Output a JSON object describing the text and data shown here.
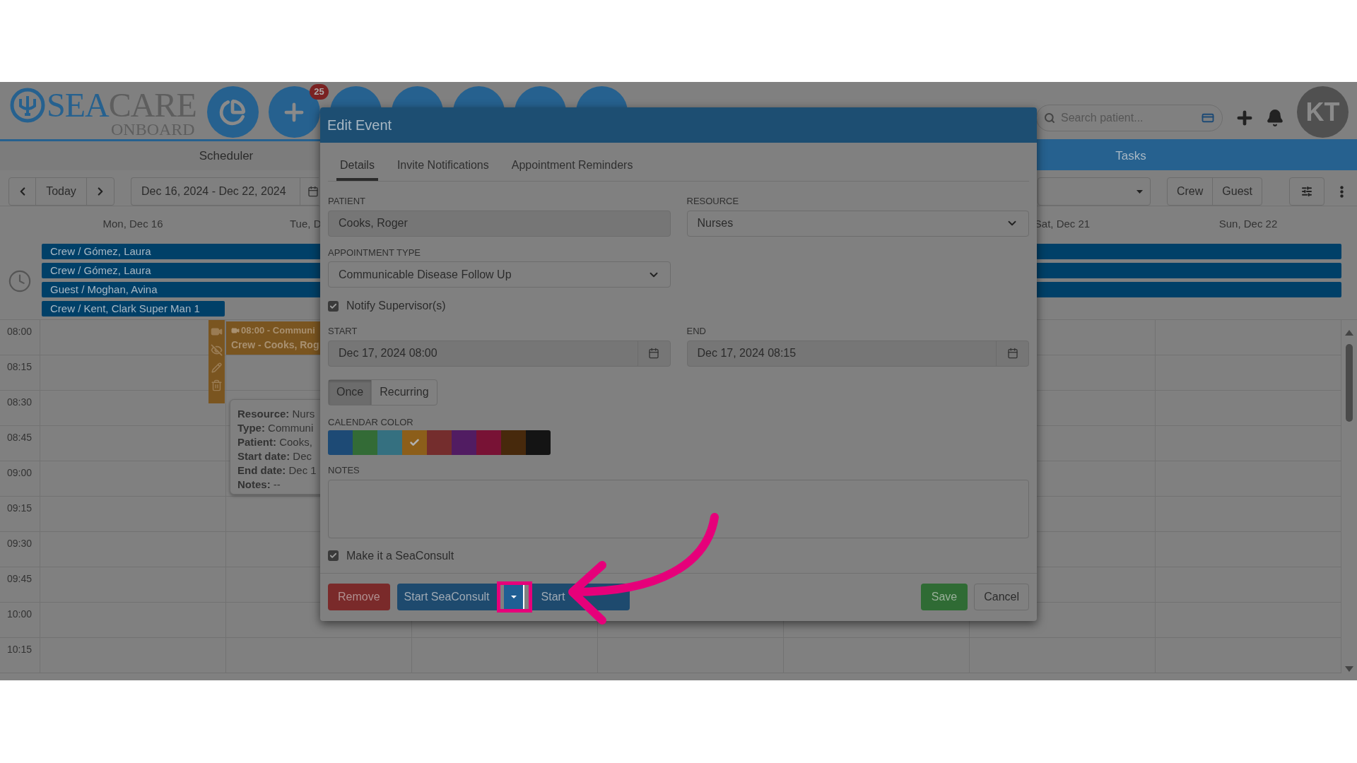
{
  "header": {
    "logo_parts": [
      "SEA",
      "CARE"
    ],
    "logo_subtitle": "ONBOARD",
    "nav_buttons": [
      {
        "kind": "pie"
      },
      {
        "kind": "add",
        "badge": "25"
      },
      {
        "kind": "plain"
      },
      {
        "kind": "plain"
      },
      {
        "kind": "plain"
      },
      {
        "kind": "plain"
      },
      {
        "kind": "plain"
      }
    ],
    "search": {
      "placeholder": "Search patient..."
    },
    "avatar": {
      "initials": "KT"
    }
  },
  "module_tabs": [
    {
      "label": "Scheduler",
      "selected": true
    },
    {
      "label": "Tasks",
      "selected": false
    }
  ],
  "toolbar": {
    "today": "Today",
    "date_range": "Dec 16, 2024 - Dec 22, 2024",
    "filter_buttons": [
      "Crew",
      "Guest"
    ]
  },
  "day_headers": [
    {
      "label": "Mon, Dec 16"
    },
    {
      "label": "Tue, D"
    },
    {
      "label": "Sat, Dec 21"
    },
    {
      "label": "Sun, Dec 22"
    }
  ],
  "all_day_events": [
    {
      "label": "Crew / Gómez, Laura",
      "kind": "week"
    },
    {
      "label": "Crew / Gómez, Laura",
      "kind": "week"
    },
    {
      "label": "Guest / Moghan, Avina",
      "kind": "week"
    },
    {
      "label": "Crew / Kent, Clark Super Man 1",
      "kind": "day"
    }
  ],
  "time_slots": [
    "08:00",
    "08:15",
    "08:30",
    "08:45",
    "09:00",
    "09:15",
    "09:30",
    "09:45",
    "10:00",
    "10:15"
  ],
  "event": {
    "title": "08:00 - Communi",
    "subtitle": "Crew - Cooks, Rog"
  },
  "tooltip": {
    "lines": [
      "**Resource:** Nurs",
      "**Type:** Communi",
      "**Patient:** Cooks,",
      "**Start date:** Dec",
      "**End date:** Dec 1",
      "**Notes:** --"
    ]
  },
  "modal": {
    "title": "Edit Event",
    "tabs": [
      {
        "label": "Details",
        "selected": true
      },
      {
        "label": "Invite Notifications",
        "selected": false
      },
      {
        "label": "Appointment Reminders",
        "selected": false
      }
    ],
    "patient": {
      "label": "PATIENT",
      "value": "Cooks, Roger"
    },
    "resource": {
      "label": "RESOURCE",
      "value": "Nurses"
    },
    "appointment_type": {
      "label": "APPOINTMENT TYPE",
      "value": "Communicable Disease Follow Up"
    },
    "notify": {
      "label": "Notify Supervisor(s)",
      "checked": true
    },
    "start": {
      "label": "START",
      "value": "Dec 17, 2024 08:00"
    },
    "end": {
      "label": "END",
      "value": "Dec 17, 2024 08:15"
    },
    "recurrence": [
      {
        "label": "Once",
        "selected": true
      },
      {
        "label": "Recurring",
        "selected": false
      }
    ],
    "calendar_color": {
      "label": "CALENDAR COLOR",
      "swatches": [
        {
          "color": "#1d4a75",
          "selected": false
        },
        {
          "color": "#336b36",
          "selected": false
        },
        {
          "color": "#357080",
          "selected": false
        },
        {
          "color": "#8c5e1a",
          "selected": true
        },
        {
          "color": "#742d2d",
          "selected": false
        },
        {
          "color": "#511c62",
          "selected": false
        },
        {
          "color": "#781235",
          "selected": false
        },
        {
          "color": "#47290c",
          "selected": false
        },
        {
          "color": "#141414",
          "selected": false
        }
      ]
    },
    "notes": {
      "label": "NOTES"
    },
    "seaconsult": {
      "label": "Make it a SeaConsult",
      "checked": true
    },
    "buttons": {
      "remove": "Remove",
      "start_seaconsult": "Start SeaConsult",
      "start": "Start",
      "save": "Save",
      "cancel": "Cancel"
    }
  }
}
